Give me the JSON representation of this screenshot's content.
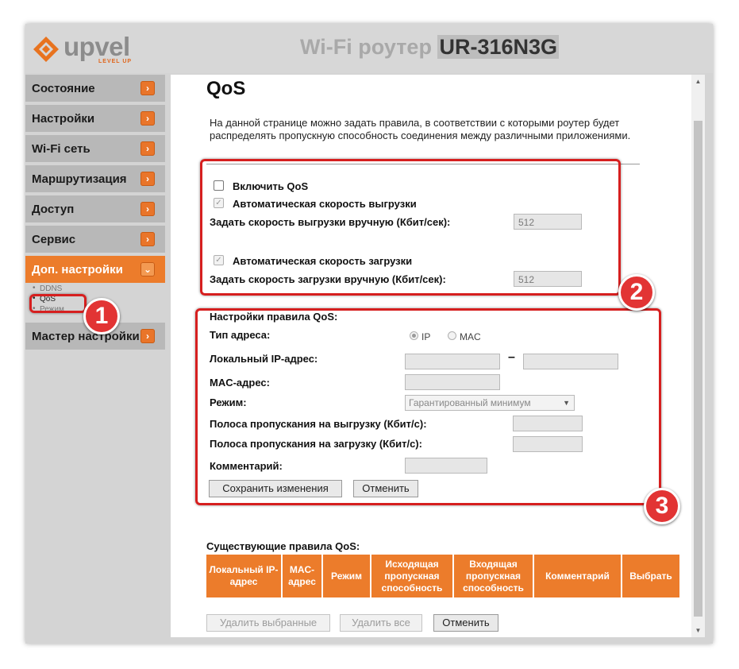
{
  "header": {
    "logo_text": "upvel",
    "logo_tagline": "LEVEL UP",
    "title_prefix": "Wi-Fi роутер",
    "title_model": "UR-316N3G"
  },
  "sidebar": {
    "items": [
      {
        "label": "Состояние"
      },
      {
        "label": "Настройки"
      },
      {
        "label": "Wi-Fi сеть"
      },
      {
        "label": "Маршрутизация"
      },
      {
        "label": "Доступ"
      },
      {
        "label": "Сервис"
      },
      {
        "label": "Доп. настройки"
      },
      {
        "label": "Мастер настройки"
      }
    ],
    "arrow_glyph": "›",
    "expanded_arrow_glyph": "⌄",
    "submenu": [
      "DDNS",
      "QoS",
      "Режим"
    ]
  },
  "page": {
    "title": "QoS",
    "description": "На данной странице можно задать правила, в соответствии с которыми роутер будет распределять пропускную способность соединения между различными приложениями."
  },
  "qos_main": {
    "enable_label": "Включить QoS",
    "auto_upload_label": "Автоматическая скорость выгрузки",
    "manual_upload_label": "Задать скорость выгрузки вручную (Кбит/сек):",
    "manual_upload_value": "512",
    "auto_download_label": "Автоматическая скорость загрузки",
    "manual_download_label": "Задать скорость загрузки вручную (Кбит/сек):",
    "manual_download_value": "512"
  },
  "rule": {
    "heading": "Настройки правила QoS:",
    "addr_type_label": "Тип адреса:",
    "radio_ip": "IP",
    "radio_mac": "MAC",
    "local_ip_label": "Локальный IP-адрес:",
    "range_dash": "–",
    "mac_label": "MAC-адрес:",
    "mode_label": "Режим:",
    "mode_value": "Гарантированный минимум",
    "upload_bw_label": "Полоса пропускания на выгрузку (Кбит/с):",
    "download_bw_label": "Полоса пропускания на загрузку (Кбит/с):",
    "comment_label": "Комментарий:",
    "save_button": "Сохранить изменения",
    "cancel_button": "Отменить"
  },
  "existing": {
    "heading": "Существующие правила QoS:",
    "columns": [
      "Локальный IP-адрес",
      "MAC-адрес",
      "Режим",
      "Исходящая пропускная способность",
      "Входящая пропускная способность",
      "Комментарий",
      "Выбрать"
    ],
    "delete_selected": "Удалить выбранные",
    "delete_all": "Удалить все",
    "cancel": "Отменить"
  },
  "annotations": {
    "badge1": "1",
    "badge2": "2",
    "badge3": "3",
    "accent_color": "#d61f1f"
  },
  "colors": {
    "brand_orange": "#ec7c2b",
    "nav_gray": "#b8b8b8"
  }
}
